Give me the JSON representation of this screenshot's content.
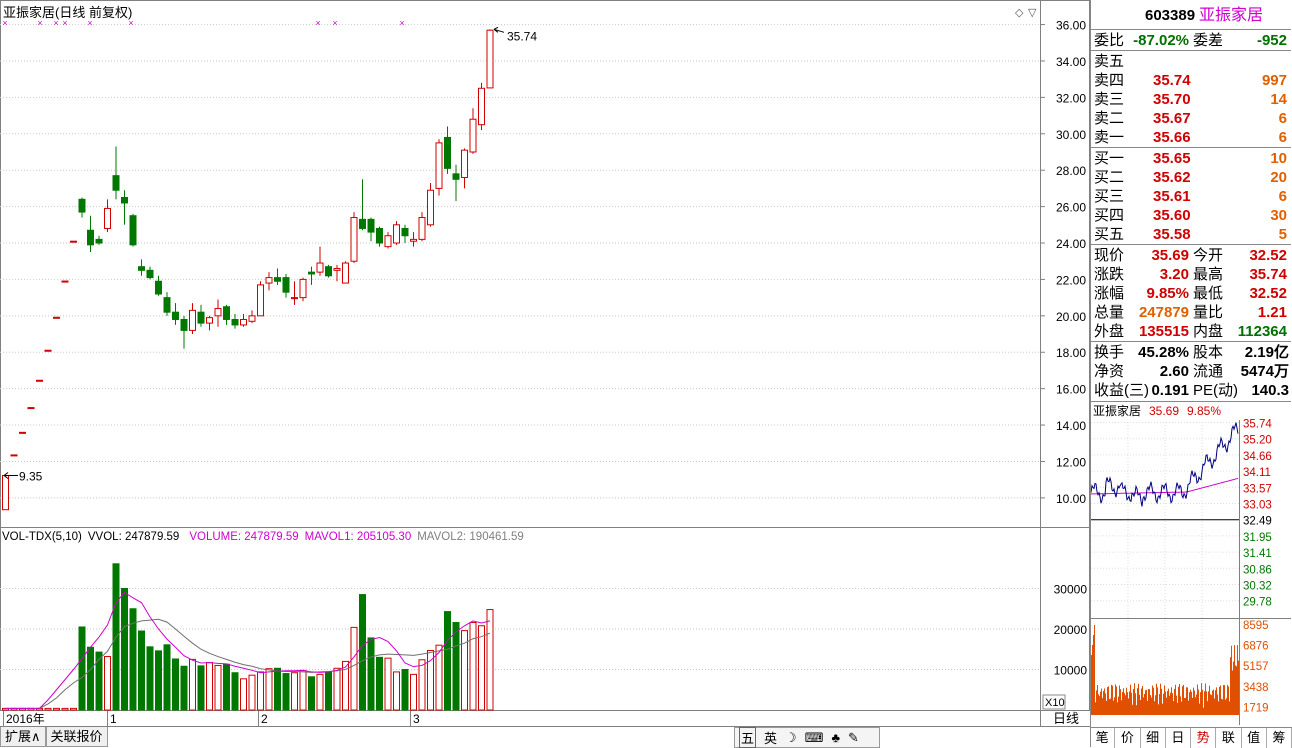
{
  "kline": {
    "title": "亚振家居(日线 前复权)",
    "price_axis": {
      "min": 8.4,
      "max": 36.8,
      "ticks": [
        "36.00",
        "34.00",
        "32.00",
        "30.00",
        "28.00",
        "26.00",
        "24.00",
        "22.00",
        "20.00",
        "18.00",
        "16.00",
        "14.00",
        "12.00",
        "10.00"
      ]
    },
    "high_label": "35.74",
    "low_label": "9.35",
    "x_labels": [
      "2016年",
      "1",
      "2",
      "3"
    ],
    "period_label": "日线",
    "candles": [
      [
        9.35,
        9.35,
        11.23,
        11.23
      ],
      [
        12.36,
        12.36,
        12.36,
        12.36
      ],
      [
        13.6,
        13.6,
        13.6,
        13.6
      ],
      [
        14.96,
        14.96,
        14.96,
        14.96
      ],
      [
        16.46,
        16.46,
        16.46,
        16.46
      ],
      [
        18.11,
        18.11,
        18.11,
        18.11
      ],
      [
        19.92,
        19.92,
        19.92,
        19.92
      ],
      [
        21.91,
        21.91,
        21.91,
        21.91
      ],
      [
        24.1,
        24.1,
        24.1,
        24.1
      ],
      [
        26.4,
        26.5,
        25.4,
        25.7
      ],
      [
        24.7,
        25.5,
        23.5,
        23.9
      ],
      [
        24.2,
        24.4,
        23.9,
        24.0
      ],
      [
        24.8,
        26.4,
        24.6,
        25.9
      ],
      [
        27.7,
        29.3,
        26.4,
        26.9
      ],
      [
        26.5,
        26.9,
        25.0,
        26.2
      ],
      [
        25.5,
        25.6,
        23.8,
        23.9
      ],
      [
        22.7,
        23.1,
        22.2,
        22.5
      ],
      [
        22.5,
        22.7,
        22.0,
        22.1
      ],
      [
        21.9,
        22.2,
        21.1,
        21.2
      ],
      [
        21.0,
        21.3,
        20.0,
        20.2
      ],
      [
        20.2,
        20.7,
        19.5,
        19.8
      ],
      [
        19.8,
        20.0,
        18.2,
        19.2
      ],
      [
        19.2,
        20.7,
        19.0,
        20.3
      ],
      [
        20.2,
        20.6,
        19.4,
        19.6
      ],
      [
        19.6,
        20.0,
        19.2,
        19.9
      ],
      [
        20.0,
        20.9,
        19.4,
        20.4
      ],
      [
        20.5,
        20.6,
        19.5,
        19.8
      ],
      [
        19.8,
        20.1,
        19.3,
        19.5
      ],
      [
        19.5,
        20.1,
        19.4,
        19.8
      ],
      [
        19.7,
        20.3,
        19.6,
        20.0
      ],
      [
        20.0,
        21.9,
        20.0,
        21.7
      ],
      [
        21.8,
        22.4,
        21.4,
        22.1
      ],
      [
        22.1,
        22.6,
        21.7,
        21.9
      ],
      [
        22.1,
        22.3,
        21.0,
        21.3
      ],
      [
        21.0,
        21.9,
        20.6,
        21.0
      ],
      [
        21.0,
        22.1,
        20.8,
        22.0
      ],
      [
        22.4,
        22.7,
        21.7,
        22.3
      ],
      [
        22.4,
        23.8,
        22.2,
        22.9
      ],
      [
        22.7,
        22.8,
        22.1,
        22.2
      ],
      [
        22.5,
        22.8,
        21.9,
        22.6
      ],
      [
        21.8,
        23.0,
        21.8,
        22.9
      ],
      [
        23.0,
        25.7,
        22.9,
        25.4
      ],
      [
        25.3,
        27.5,
        24.7,
        24.8
      ],
      [
        25.3,
        25.4,
        24.1,
        24.6
      ],
      [
        24.8,
        24.9,
        23.8,
        24.0
      ],
      [
        23.8,
        24.6,
        23.7,
        24.4
      ],
      [
        24.0,
        25.2,
        23.9,
        25.0
      ],
      [
        24.8,
        25.0,
        24.0,
        24.4
      ],
      [
        24.1,
        24.6,
        23.8,
        24.2
      ],
      [
        24.2,
        25.7,
        24.1,
        25.4
      ],
      [
        25.0,
        27.3,
        24.9,
        26.9
      ],
      [
        27.0,
        29.7,
        26.6,
        29.5
      ],
      [
        29.8,
        30.4,
        27.8,
        28.1
      ],
      [
        27.8,
        28.3,
        26.3,
        27.5
      ],
      [
        27.6,
        29.2,
        27.0,
        29.1
      ],
      [
        29.0,
        31.4,
        28.9,
        30.8
      ],
      [
        30.5,
        32.8,
        30.2,
        32.5
      ],
      [
        32.52,
        35.74,
        32.52,
        35.69
      ]
    ],
    "volumes": [
      400,
      400,
      400,
      400,
      400,
      400,
      400,
      400,
      400,
      20500,
      15500,
      14300,
      13200,
      36100,
      30000,
      25000,
      19500,
      15600,
      14600,
      16100,
      12600,
      10800,
      12500,
      10900,
      11700,
      11000,
      11300,
      9200,
      7700,
      8600,
      9400,
      10200,
      10300,
      9000,
      9200,
      9700,
      8200,
      8800,
      9300,
      10300,
      12000,
      20400,
      28500,
      17800,
      13000,
      12800,
      9400,
      10000,
      8800,
      12400,
      14700,
      16000,
      24300,
      21600,
      19600,
      21600,
      20800,
      24800
    ],
    "ma5": [
      400,
      400,
      400,
      400,
      400,
      2500,
      5000,
      7500,
      10000,
      12700,
      15500,
      18000,
      21000,
      26500,
      29000,
      27700,
      26500,
      23000,
      20000,
      17500,
      15500,
      13400,
      12300,
      11600,
      11700,
      11500,
      11400,
      10800,
      10300,
      9800,
      9200,
      9400,
      9600,
      9700,
      9700,
      9800,
      9400,
      9300,
      9400,
      9800,
      10600,
      13100,
      16000,
      17400,
      17900,
      16900,
      14600,
      11600,
      10700,
      11000,
      12200,
      14200,
      17200,
      19300,
      20800,
      22000,
      21500,
      22000
    ],
    "ma10": [
      400,
      400,
      400,
      400,
      400,
      1500,
      3000,
      5000,
      6700,
      8000,
      10000,
      12500,
      14500,
      18000,
      20600,
      21400,
      22000,
      22200,
      22400,
      21700,
      20000,
      18200,
      16500,
      15000,
      14000,
      13200,
      12500,
      11800,
      11200,
      10800,
      10200,
      9900,
      9600,
      9500,
      9500,
      9400,
      9300,
      9400,
      9500,
      9700,
      10000,
      11000,
      12200,
      13100,
      13600,
      13800,
      13700,
      13600,
      13500,
      13800,
      14200,
      14600,
      15000,
      15800,
      16500,
      17600,
      18100,
      19000
    ],
    "vol_axis": {
      "max": 40000,
      "ticks": [
        "30000",
        "20000",
        "10000"
      ]
    },
    "vol_header": {
      "name": "VOL-TDX(5,10)",
      "vvol": "VVOL: 247879.59",
      "volume": "VOLUME: 247879.59",
      "mavol1": "MAVOL1: 205105.30",
      "mavol2": "MAVOL2: 190461.59"
    },
    "vol_scale": "X10",
    "markers_x": [
      5,
      40,
      56,
      65,
      90,
      131,
      318,
      335,
      402
    ]
  },
  "quote": {
    "code": "603389",
    "name": "亚振家居",
    "weibi_label": "委比",
    "weibi": "-87.02%",
    "weicha_label": "委差",
    "weicha": "-952",
    "asks": [
      {
        "label": "卖五",
        "price": "",
        "vol": ""
      },
      {
        "label": "卖四",
        "price": "35.74",
        "vol": "997"
      },
      {
        "label": "卖三",
        "price": "35.70",
        "vol": "14"
      },
      {
        "label": "卖二",
        "price": "35.67",
        "vol": "6"
      },
      {
        "label": "卖一",
        "price": "35.66",
        "vol": "6"
      }
    ],
    "bids": [
      {
        "label": "买一",
        "price": "35.65",
        "vol": "10"
      },
      {
        "label": "买二",
        "price": "35.62",
        "vol": "20"
      },
      {
        "label": "买三",
        "price": "35.61",
        "vol": "6"
      },
      {
        "label": "买四",
        "price": "35.60",
        "vol": "30"
      },
      {
        "label": "买五",
        "price": "35.58",
        "vol": "5"
      }
    ],
    "stats": [
      {
        "l1": "现价",
        "v1": "35.69",
        "c1": "red",
        "l2": "今开",
        "v2": "32.52",
        "c2": "red"
      },
      {
        "l1": "涨跌",
        "v1": "3.20",
        "c1": "red",
        "l2": "最高",
        "v2": "35.74",
        "c2": "red"
      },
      {
        "l1": "涨幅",
        "v1": "9.85%",
        "c1": "red",
        "l2": "最低",
        "v2": "32.52",
        "c2": "red"
      },
      {
        "l1": "总量",
        "v1": "247879",
        "c1": "org",
        "l2": "量比",
        "v2": "1.21",
        "c2": "red"
      },
      {
        "l1": "外盘",
        "v1": "135515",
        "c1": "red",
        "l2": "内盘",
        "v2": "112364",
        "c2": "grn"
      }
    ],
    "fund": [
      {
        "l1": "换手",
        "v1": "45.28%",
        "l2": "股本",
        "v2": "2.19亿"
      },
      {
        "l1": "净资",
        "v1": "2.60",
        "l2": "流通",
        "v2": "5474万"
      },
      {
        "l1": "收益(三)",
        "v1": "0.191",
        "l2": "PE(动)",
        "v2": "140.3"
      }
    ]
  },
  "mini": {
    "name": "亚振家居",
    "price": "35.69",
    "pct": "9.85%",
    "price_ticks": [
      "35.74",
      "35.20",
      "34.66",
      "34.11",
      "33.57",
      "33.03",
      "32.49",
      "31.95",
      "31.41",
      "30.86",
      "30.32",
      "29.78"
    ],
    "vol_ticks": [
      "8595",
      "6876",
      "5157",
      "3438",
      "1719"
    ]
  },
  "bottom_tabs": [
    "扩展∧",
    "关联报价"
  ],
  "ime": [
    "五",
    "英",
    "☽",
    "⌨",
    "♣",
    "✎"
  ],
  "right_tabs": [
    "笔",
    "价",
    "细",
    "日",
    "势",
    "联",
    "值",
    "筹"
  ],
  "colors": {
    "up": "#d00000",
    "down": "#007800",
    "ma1": "#d000d0",
    "ma2": "#707070"
  }
}
